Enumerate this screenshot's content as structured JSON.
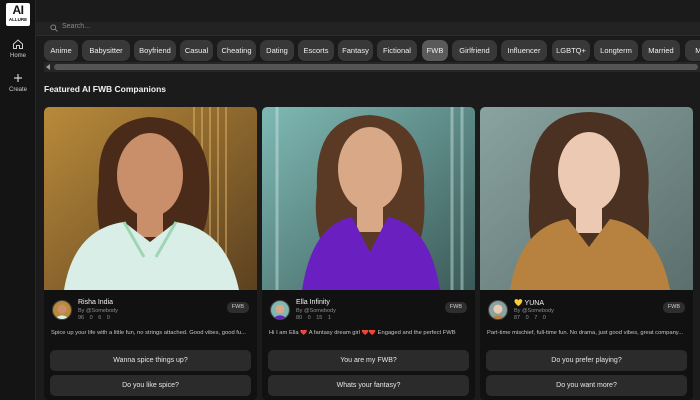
{
  "brand": {
    "logo_main": "AI",
    "logo_sub": "ALLURE"
  },
  "nav": [
    {
      "label": "Home",
      "icon": "home-icon"
    },
    {
      "label": "Create",
      "icon": "plus-icon"
    }
  ],
  "search": {
    "placeholder": "Search..."
  },
  "categories": [
    {
      "label": "Anime",
      "active": false
    },
    {
      "label": "Babysitter",
      "active": false
    },
    {
      "label": "Boyfriend",
      "active": false
    },
    {
      "label": "Casual",
      "active": false
    },
    {
      "label": "Cheating",
      "active": false
    },
    {
      "label": "Dating",
      "active": false
    },
    {
      "label": "Escorts",
      "active": false
    },
    {
      "label": "Fantasy",
      "active": false
    },
    {
      "label": "Fictional",
      "active": false
    },
    {
      "label": "FWB",
      "active": true
    },
    {
      "label": "Girlfriend",
      "active": false
    },
    {
      "label": "Influencer",
      "active": false
    },
    {
      "label": "LGBTQ+",
      "active": false
    },
    {
      "label": "Longterm",
      "active": false
    },
    {
      "label": "Married",
      "active": false
    },
    {
      "label": "Mil",
      "active": false
    }
  ],
  "section_title": "Featured AI FWB Companions",
  "cards": [
    {
      "name": "Risha India",
      "by": "By @Somebody",
      "stats": [
        "96",
        "0",
        "6",
        "0"
      ],
      "badge": "FWB",
      "description": "Spice up your life with a little fun, no strings attached. Good vibes, good fu...",
      "buttons": [
        "Wanna spice things up?",
        "Do you like spice?"
      ],
      "colors": {
        "bg_a": "#b98a3a",
        "bg_b": "#5c4120",
        "skin": "#c98e6a",
        "hair": "#4a2b1a",
        "top": "#d9eee6"
      }
    },
    {
      "name": "Ella Infinity",
      "by": "By @Somebody",
      "stats": [
        "80",
        "0",
        "15",
        "1"
      ],
      "badge": "FWB",
      "description": "Hi I am Ella ❤️ A fantasy dream girl ❤️❤️ Engaged and the perfect FWB",
      "buttons": [
        "You are my FWB?",
        "Whats your fantasy?"
      ],
      "colors": {
        "bg_a": "#7fb9b4",
        "bg_b": "#3b5a58",
        "skin": "#d9a887",
        "hair": "#5a3a24",
        "top": "#6a1fc0"
      }
    },
    {
      "name": "💛 YUNA",
      "by": "By @Somebody",
      "stats": [
        "87",
        "0",
        "7",
        "0"
      ],
      "badge": "FWB",
      "description": "Part-time mischief, full-time fun. No drama, just good vibes, great company...",
      "buttons": [
        "Do you prefer playing?",
        "Do you want more?"
      ],
      "colors": {
        "bg_a": "#8aa3a0",
        "bg_b": "#5b6f6d",
        "skin": "#ecc9b2",
        "hair": "#4b3121",
        "top": "#b7823f"
      }
    }
  ]
}
